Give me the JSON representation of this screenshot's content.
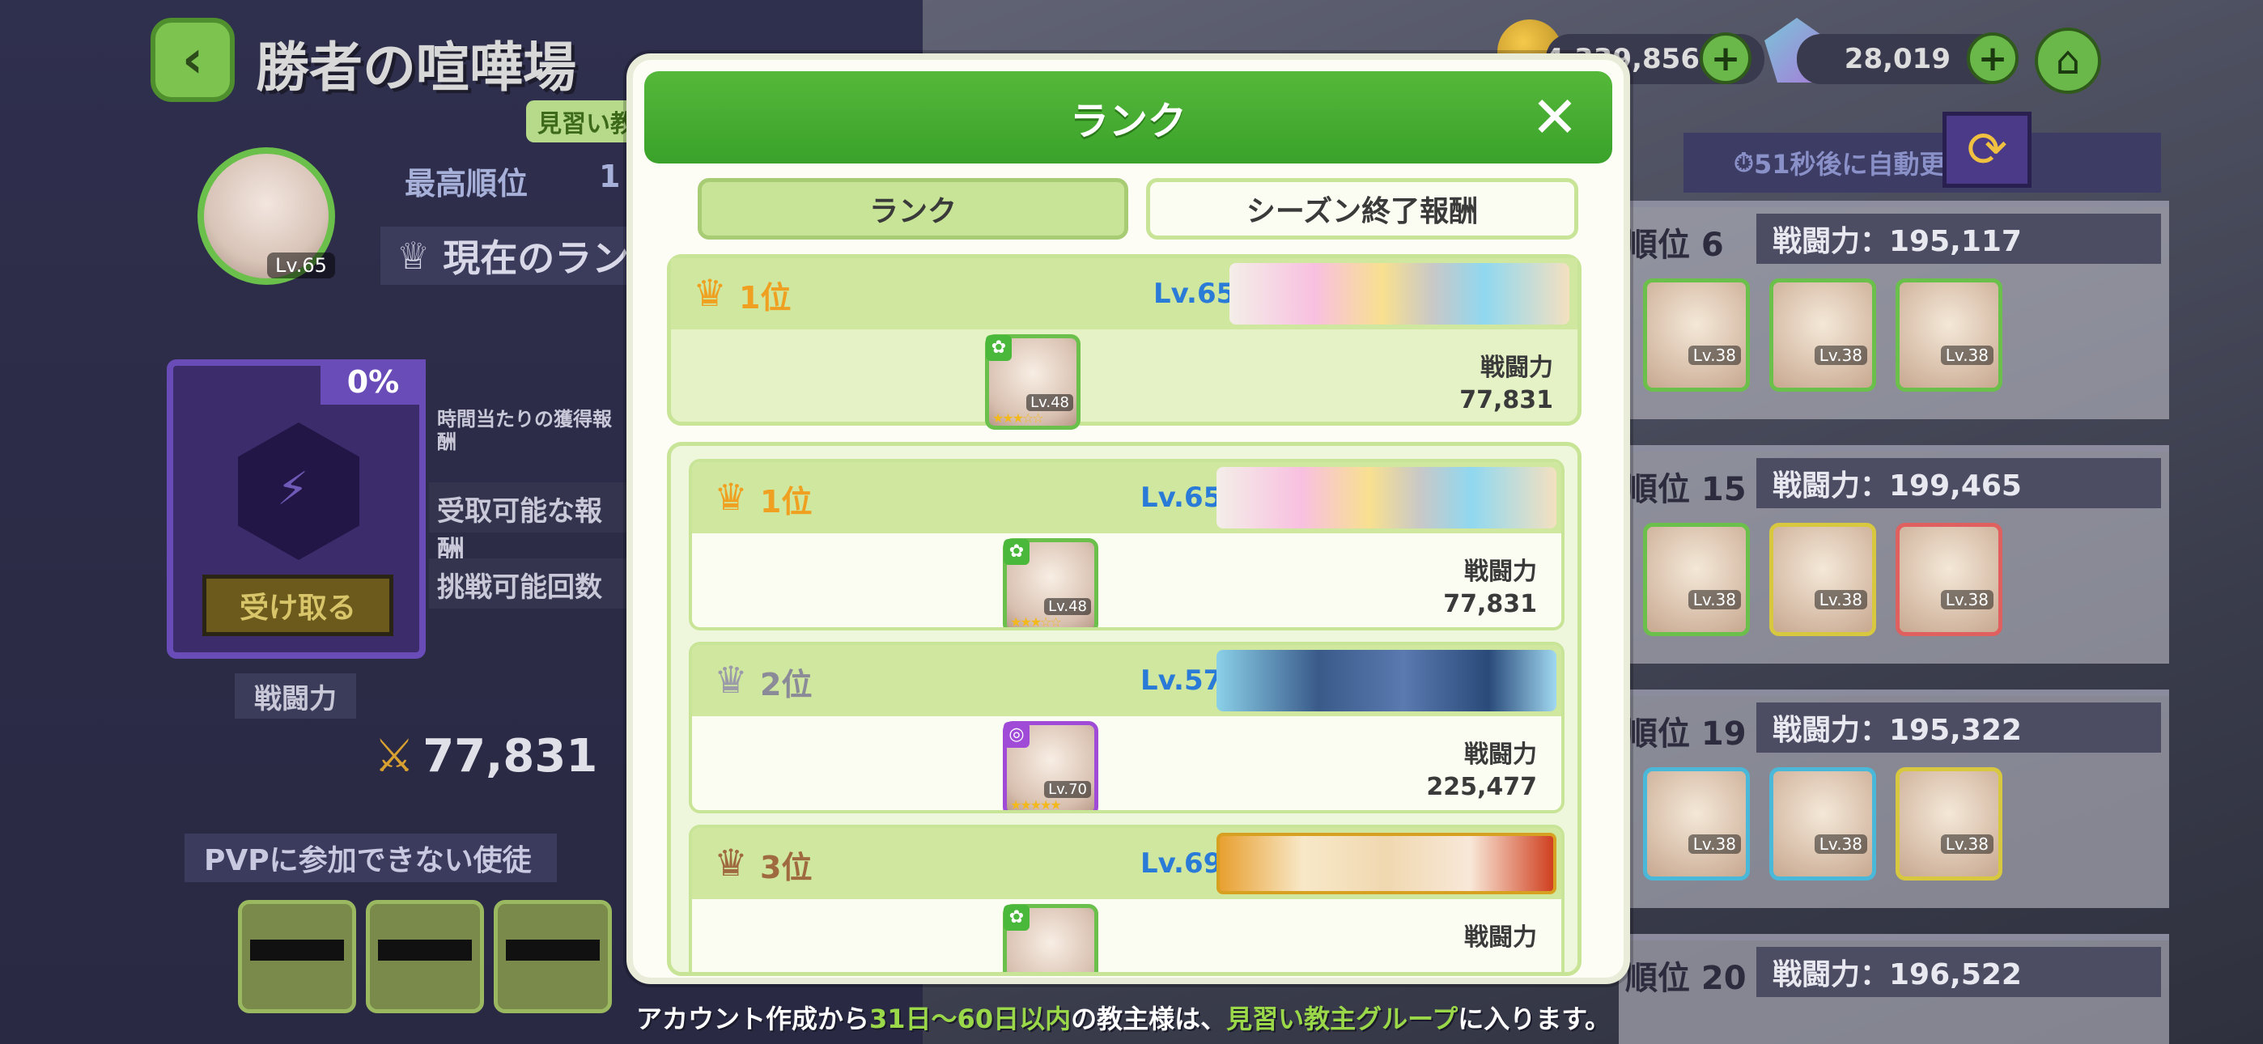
{
  "header": {
    "title": "勝者の喧嘩場",
    "group_badge": "見習い教",
    "avatar_level": "Lv.65"
  },
  "profile": {
    "best_rank_label": "最高順位",
    "best_rank_value": "1",
    "current_rank_label": "現在のラン",
    "reward_percent": "0%",
    "hourly_reward_label": "時間当たりの獲得報酬",
    "claimable_label": "受取可能な報酬",
    "attempts_label": "挑戦可能回数",
    "claim_button": "受け取る",
    "power_label": "戦闘力",
    "power_value": "77,831",
    "pvp_unavailable_label": "PVPに参加できない使徒"
  },
  "currency": {
    "gold": "4,339,856",
    "gems": "28,019"
  },
  "opponents": {
    "auto_update": "51秒後に自動更新",
    "rows": [
      {
        "rank": "順位 6",
        "power": "戦闘力：195,117",
        "levels": [
          "Lv.38",
          "Lv.38",
          "Lv.38"
        ]
      },
      {
        "rank": "順位 15",
        "power": "戦闘力：199,465",
        "levels": [
          "Lv.38",
          "Lv.38",
          "Lv.38"
        ]
      },
      {
        "rank": "順位 19",
        "power": "戦闘力：195,322",
        "levels": [
          "Lv.38",
          "Lv.38",
          "Lv.38"
        ]
      },
      {
        "rank": "順位 20",
        "power": "戦闘力：196,522",
        "levels": []
      }
    ]
  },
  "modal": {
    "title": "ランク",
    "tabs": {
      "rank": "ランク",
      "season_rewards": "シーズン終了報酬"
    },
    "my_entry": {
      "rank": "1位",
      "level": "Lv.65",
      "unit_level": "Lv.48",
      "power_label": "戦闘力",
      "power": "77,831"
    },
    "entries": [
      {
        "rank": "1位",
        "level": "Lv.65",
        "unit_level": "Lv.48",
        "power_label": "戦闘力",
        "power": "77,831"
      },
      {
        "rank": "2位",
        "level": "Lv.57",
        "unit_level": "Lv.70",
        "power_label": "戦闘力",
        "power": "225,477"
      },
      {
        "rank": "3位",
        "level": "Lv.69",
        "unit_level": "",
        "power_label": "戦闘力",
        "power": ""
      }
    ]
  },
  "footer": {
    "part1": "アカウント作成から",
    "part2": "31日～60日以内",
    "part3": "の教主様は、",
    "part4": "見習い教主グループ",
    "part5": "に入ります。"
  },
  "colors": {
    "accent_green": "#3aa22a",
    "level_blue": "#2a7ad8",
    "gold_crown": "#f0a020",
    "silver_crown": "#9a9aa8",
    "bronze_crown": "#a06a40"
  }
}
